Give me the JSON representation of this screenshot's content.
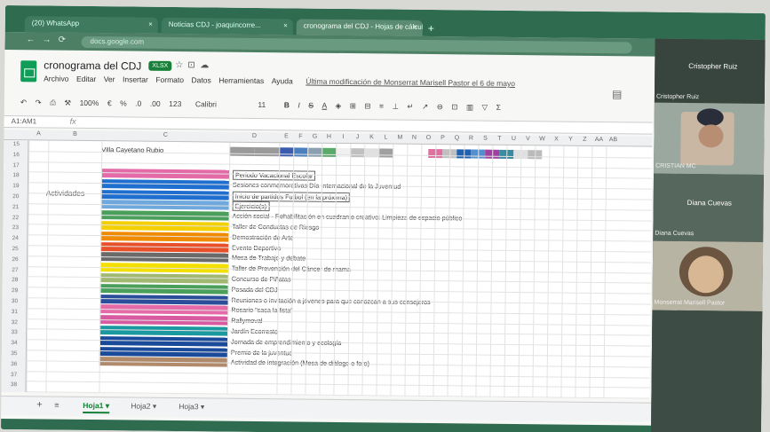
{
  "browser": {
    "tabs": [
      {
        "label": "(20) WhatsApp",
        "close": "×"
      },
      {
        "label": "Noticias CDJ - joaquincorre...",
        "close": "×"
      },
      {
        "label": "cronograma del CDJ - Hojas de cálculo",
        "close": "×"
      }
    ],
    "new_tab": "+",
    "address": "docs.google.com",
    "nav_back": "←",
    "nav_fwd": "→",
    "nav_reload": "⟳"
  },
  "sheet": {
    "title": "cronograma del CDJ",
    "badge": "XLSX",
    "star_icon": "☆",
    "move_icon": "⊡",
    "cloud_icon": "☁",
    "menu": [
      "Archivo",
      "Editar",
      "Ver",
      "Insertar",
      "Formato",
      "Datos",
      "Herramientas",
      "Ayuda"
    ],
    "last_edit": "Última modificación de Monserrat Marisell Pastor el 6 de mayo",
    "comment_icon": "▤"
  },
  "toolbar": {
    "undo": "↶",
    "redo": "↷",
    "print": "⎙",
    "paint": "⚒",
    "zoom": "100%",
    "currency": "€",
    "percent": "%",
    "dec_less": ".0",
    "dec_more": ".00",
    "format": "123",
    "font": "Calibri",
    "size": "11",
    "bold": "B",
    "italic": "I",
    "strike": "S",
    "textcolor": "A",
    "fill": "◈",
    "borders": "⊞",
    "merge": "⊟",
    "align": "≡",
    "valign": "⊥",
    "wrap": "↵",
    "rotate": "↗",
    "link": "⊖",
    "comment": "⊡",
    "chart": "▥",
    "filter": "▽",
    "sum": "Σ"
  },
  "formula_bar": {
    "namebox": "A1:AM1",
    "fx": "fx"
  },
  "grid": {
    "columns": [
      "A",
      "B",
      "C",
      "D",
      "E",
      "F",
      "G",
      "H",
      "I",
      "J",
      "K",
      "L",
      "M",
      "N",
      "O",
      "P",
      "Q",
      "R",
      "S",
      "T",
      "U",
      "V",
      "W",
      "X",
      "Y",
      "Z",
      "AA",
      "AB"
    ],
    "rows": [
      "15",
      "16",
      "17",
      "18",
      "19",
      "20",
      "21",
      "22",
      "23",
      "24",
      "25",
      "26",
      "27",
      "28",
      "29",
      "30",
      "31",
      "32",
      "33",
      "34",
      "35",
      "36",
      "37",
      "38"
    ],
    "row16_label": "Villa Cayetano Rubio",
    "row16_colors": [
      "#9a9a9a",
      "#9a9a9a",
      "#3b5bb0",
      "#4a7fc0",
      "#8aa0b0",
      "#5aaa6a",
      "#f0f0f0",
      "#c0c0c0",
      "#e0e0e0",
      "#a0a0a0",
      "#e070a0",
      "#c0c0c0",
      "#2060b0",
      "#5090d0",
      "#a040a0",
      "#3a8aa0",
      "#e0e0e0",
      "#bbbbbb"
    ],
    "section_label": "Actividades"
  },
  "activities": [
    {
      "label": "Periodo Vacacional Escolar",
      "color": "#e56aa8",
      "boxed": true
    },
    {
      "label": "Sesiones conmemorativas Día Internacional de la Juventud",
      "color": "#1f6fd0",
      "boxed": false
    },
    {
      "label": "Inicio de partidos Futbol (en la próxima)",
      "color": "#1f6fd0",
      "boxed": true
    },
    {
      "label": "Ejercicio(s)",
      "color": "#6fa8dc",
      "boxed": true
    },
    {
      "label": "Acción social - Rehabilitación en cuadrante creativo: Limpieza de espacio público",
      "color": "#4aa05a",
      "boxed": false
    },
    {
      "label": "Taller de Conductas de Riesgo",
      "color": "#f4d000",
      "boxed": false
    },
    {
      "label": "Demostración de Arte",
      "color": "#f08a00",
      "boxed": false
    },
    {
      "label": "Evento Deportivo",
      "color": "#e8502a",
      "boxed": false
    },
    {
      "label": "Mesa de Trabajo y debate",
      "color": "#6a6a6a",
      "boxed": false
    },
    {
      "label": "Taller de Prevención del Cáncer de mama",
      "color": "#f4e000",
      "boxed": false
    },
    {
      "label": "Concurso de Piñatas",
      "color": "#a0b870",
      "boxed": false
    },
    {
      "label": "Posada del CDJ",
      "color": "#4aa05a",
      "boxed": false
    },
    {
      "label": "Reuniones o invitación a jóvenes para que conozcan a sus consejeros",
      "color": "#2a4e9a",
      "boxed": false
    },
    {
      "label": "Rosario \"saca la lista\"",
      "color": "#e56aa8",
      "boxed": false
    },
    {
      "label": "Rallymoval",
      "color": "#d85aa0",
      "boxed": false
    },
    {
      "label": "Jardín Ecorresto",
      "color": "#1a9aa0",
      "boxed": false
    },
    {
      "label": "Jornada de emprendimiento y ecología",
      "color": "#1a4a9a",
      "boxed": false
    },
    {
      "label": "Premio de la juventud",
      "color": "#1a4a9a",
      "boxed": false
    },
    {
      "label": "Actividad de integración (Mesa de diálogo o foro)",
      "color": "#b08a6a",
      "boxed": false
    }
  ],
  "sheet_tabs": {
    "add": "+",
    "all": "≡",
    "tabs": [
      {
        "label": "Hoja1 ▾",
        "active": true
      },
      {
        "label": "Hoja2 ▾",
        "active": false
      },
      {
        "label": "Hoja3 ▾",
        "active": false
      }
    ],
    "explore": "✦"
  },
  "video_call": {
    "participants": [
      {
        "big": "Cristopher Ruiz",
        "small": "Cristopher Ruiz"
      },
      {
        "big": "",
        "small": "CRISTIAN MC"
      },
      {
        "big": "Diana Cuevas",
        "small": "Diana Cuevas"
      },
      {
        "big": "",
        "small": "Monserrat Marisell Pastor"
      }
    ]
  }
}
